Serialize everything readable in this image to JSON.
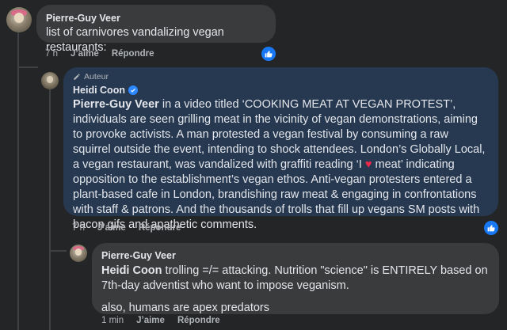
{
  "comments": [
    {
      "author": "Pierre-Guy Veer",
      "text": "list of carnivores vandalizing vegan restaurants:",
      "actions": {
        "time": "7 h",
        "like_label": "J’aime",
        "reply_label": "Répondre"
      },
      "reaction": "like"
    },
    {
      "badge_label": "Auteur",
      "author": "Heidi Coon",
      "verified": true,
      "mention": "Pierre-Guy Veer",
      "text_before_heart": " in a video titled ‘COOKING MEAT AT VEGAN PROTEST’, individuals are seen grilling meat in the vicinity of vegan demonstrations, aiming to provoke activists. A man protested a vegan festival by consuming a raw squirrel outside the event, intending to shock attendees. London’s Globally Local, a vegan restaurant, was vandalized with graffiti reading ‘I ",
      "heart": "♥",
      "text_after_heart": " meat’ indicating opposition to the establishment’s vegan ethos. Anti-vegan protesters entered a plant-based cafe in London, brandishing raw meat & engaging in confrontations with staff & patrons. And the thousands of trolls that fill up vegans SM posts with bacon gifs and apathetic comments.",
      "actions": {
        "time": "7 h",
        "like_label": "J’aime",
        "reply_label": "Répondre"
      },
      "reaction": "like"
    },
    {
      "author": "Pierre-Guy Veer",
      "mention": "Heidi Coon",
      "text": " trolling =/= attacking. Nutrition \"science\" is ENTIRELY based on 7th-day adventist who want to impose veganism.",
      "text2": "also, humans are apex predators",
      "actions": {
        "time": "1 min",
        "like_label": "J’aime",
        "reply_label": "Répondre"
      }
    }
  ],
  "colors": {
    "background": "#242526",
    "bubble": "#3a3b3c",
    "author_bubble": "#263951",
    "like_blue": "#1877f2",
    "verified_blue": "#2d88ff"
  },
  "icons": [
    "avatar",
    "pencil-icon",
    "verified-icon",
    "like-reaction-icon"
  ]
}
